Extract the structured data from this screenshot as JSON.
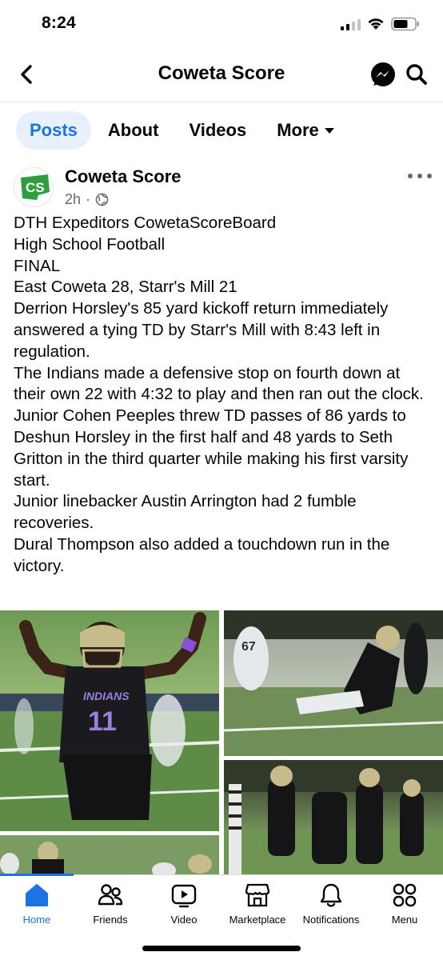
{
  "status_bar": {
    "time": "8:24"
  },
  "header": {
    "title": "Coweta Score"
  },
  "tabs": [
    {
      "label": "Posts",
      "active": true
    },
    {
      "label": "About",
      "active": false
    },
    {
      "label": "Videos",
      "active": false
    },
    {
      "label": "More",
      "active": false
    }
  ],
  "post": {
    "author": "Coweta Score",
    "time": "2h",
    "separator": "·",
    "avatar_text": "CS",
    "lines": [
      "DTH Expeditors CowetaScoreBoard",
      "High School Football",
      "FINAL",
      "East Coweta 28, Starr's Mill 21",
      "Derrion Horsley's 85 yard kickoff return immediately answered a tying TD by Starr's Mill with 8:43 left in regulation.",
      "The Indians made a defensive stop on fourth down at their own 22 with 4:32 to play and then ran out the clock.",
      "Junior Cohen Peeples threw TD passes of 86 yards to Deshun Horsley in the first half and 48 yards to Seth Gritton in the third quarter while making his first varsity start.",
      "Junior linebacker Austin Arrington had 2 fumble recoveries.",
      "Dural Thompson also added a touchdown run in the victory."
    ],
    "photos": {
      "jersey_text": "INDIANS",
      "jersey_number": "11",
      "opponent_number": "67"
    }
  },
  "bottom_nav": [
    {
      "label": "Home",
      "icon": "home-icon",
      "active": true
    },
    {
      "label": "Friends",
      "icon": "friends-icon",
      "active": false
    },
    {
      "label": "Video",
      "icon": "video-icon",
      "active": false
    },
    {
      "label": "Marketplace",
      "icon": "marketplace-icon",
      "active": false
    },
    {
      "label": "Notifications",
      "icon": "bell-icon",
      "active": false
    },
    {
      "label": "Menu",
      "icon": "menu-grid-icon",
      "active": false
    }
  ],
  "colors": {
    "accent": "#1b74e4",
    "tab_active_bg": "#e7f0fc",
    "text": "#050505",
    "secondary_text": "#65676b",
    "logo_green": "#2e9e3e"
  }
}
